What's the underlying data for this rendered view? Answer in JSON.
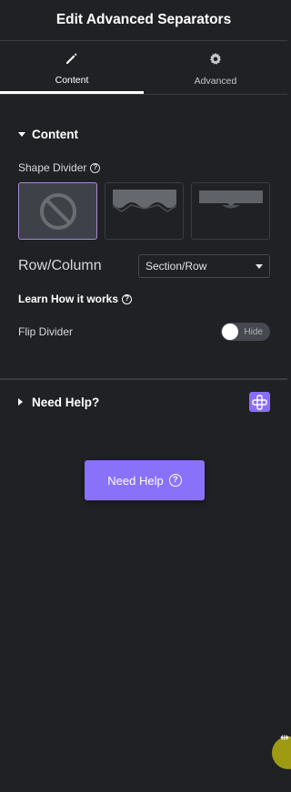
{
  "header": {
    "title": "Edit Advanced Separators"
  },
  "tabs": [
    {
      "label": "Content",
      "icon": "pencil-icon",
      "active": true
    },
    {
      "label": "Advanced",
      "icon": "gear-icon",
      "active": false
    }
  ],
  "content_section": {
    "title": "Content",
    "shape_divider_label": "Shape Divider",
    "shapes": [
      {
        "name": "none",
        "icon": "ban-icon",
        "selected": true
      },
      {
        "name": "waves",
        "icon": "wave-shape-icon",
        "selected": false
      },
      {
        "name": "drop",
        "icon": "drop-shape-icon",
        "selected": false
      }
    ],
    "row_column_label": "Row/Column",
    "row_column_value": "Section/Row",
    "learn_label": "Learn How it works",
    "flip_label": "Flip Divider",
    "flip_toggle_text": "Hide"
  },
  "need_help_section": {
    "title": "Need Help?",
    "button_label": "Need Help"
  },
  "colors": {
    "accent": "#8a71fa",
    "selected_border": "#a48ad6",
    "background": "#202125"
  }
}
